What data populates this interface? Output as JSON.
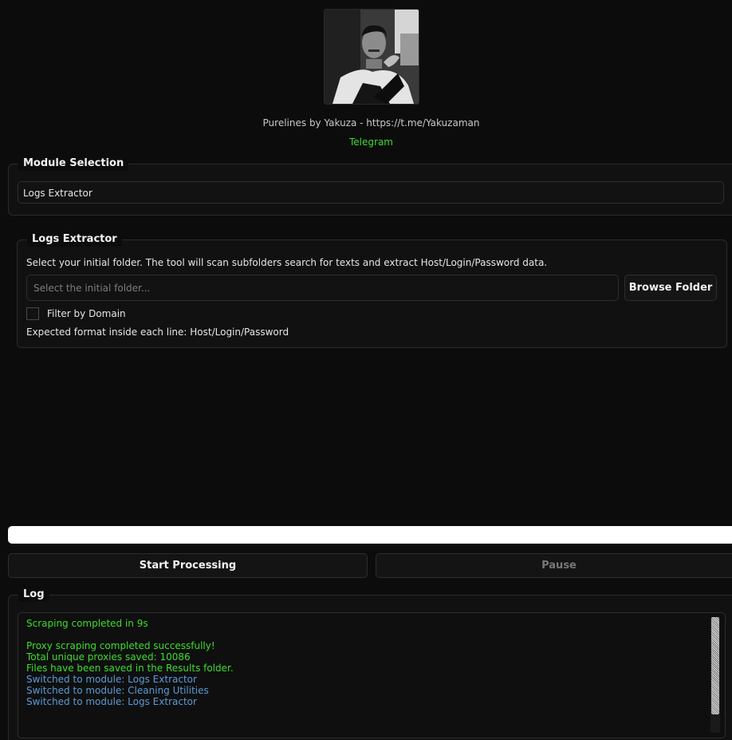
{
  "header": {
    "avatar_icon": "profile-photo",
    "credits": "Purelines by Yakuza - https://t.me/Yakuzaman",
    "telegram_link": "Telegram"
  },
  "module_selection": {
    "title": "Module Selection",
    "selected_value": "Logs Extractor"
  },
  "logs_extractor": {
    "title": "Logs Extractor",
    "description": "Select your initial folder. The tool will scan subfolders search for texts and extract Host/Login/Password data.",
    "folder_input_value": "",
    "folder_input_placeholder": "Select the initial folder...",
    "browse_label": "Browse Folder",
    "filter_label": "Filter by Domain",
    "filter_checked": false,
    "format_hint": "Expected format inside each line: Host/Login/Password"
  },
  "progress": {
    "value_fraction": 1.0
  },
  "actions": {
    "start_label": "Start Processing",
    "pause_label": "Pause",
    "pause_enabled": false
  },
  "log": {
    "title": "Log",
    "lines": [
      {
        "text": "Scraping completed in 9s",
        "color": "#3ddc2d"
      },
      {
        "text": "",
        "color": "#3ddc2d"
      },
      {
        "text": "Proxy scraping completed successfully!",
        "color": "#3ddc2d"
      },
      {
        "text": "Total unique proxies saved: 10086",
        "color": "#3ddc2d"
      },
      {
        "text": "Files have been saved in the Results folder.",
        "color": "#3ddc2d"
      },
      {
        "text": "Switched to module: Logs Extractor",
        "color": "#5b9bd5"
      },
      {
        "text": "Switched to module: Cleaning Utilities",
        "color": "#5b9bd5"
      },
      {
        "text": "Switched to module: Logs Extractor",
        "color": "#5b9bd5"
      }
    ]
  },
  "colors": {
    "background": "#0c0c0c",
    "accent_green": "#3ddc2d",
    "accent_blue": "#5b9bd5",
    "text": "#e6e6e6",
    "disabled_text": "#777777"
  }
}
